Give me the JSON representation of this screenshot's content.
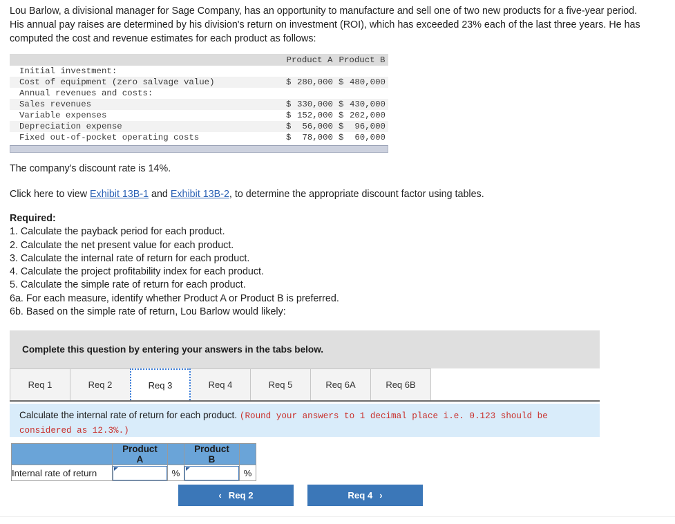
{
  "intro": {
    "paragraph": "Lou Barlow, a divisional manager for Sage Company, has an opportunity to manufacture and sell one of two new products for a five-year period. His annual pay raises are determined by his division's return on investment (ROI), which has exceeded 23% each of the last three years. He has computed the cost and revenue estimates for each product as follows:"
  },
  "fin_table": {
    "col_headers": [
      "",
      "Product A",
      "Product B"
    ],
    "rows": [
      {
        "label": "Initial investment:",
        "a_cur": "",
        "a_val": "",
        "b_cur": "",
        "b_val": ""
      },
      {
        "label": "Cost of equipment (zero salvage value)",
        "a_cur": "$",
        "a_val": "280,000",
        "b_cur": "$",
        "b_val": "480,000"
      },
      {
        "label": "Annual revenues and costs:",
        "a_cur": "",
        "a_val": "",
        "b_cur": "",
        "b_val": ""
      },
      {
        "label": "Sales revenues",
        "a_cur": "$",
        "a_val": "330,000",
        "b_cur": "$",
        "b_val": "430,000"
      },
      {
        "label": "Variable expenses",
        "a_cur": "$",
        "a_val": "152,000",
        "b_cur": "$",
        "b_val": "202,000"
      },
      {
        "label": "Depreciation expense",
        "a_cur": "$",
        "a_val": "56,000",
        "b_cur": "$",
        "b_val": "96,000"
      },
      {
        "label": "Fixed out-of-pocket operating costs",
        "a_cur": "$",
        "a_val": "78,000",
        "b_cur": "$",
        "b_val": "60,000"
      }
    ]
  },
  "discount": {
    "text": "The company's discount rate is 14%."
  },
  "exhibit_line": {
    "prefix": "Click here to view ",
    "link1": "Exhibit 13B-1",
    "middle": " and ",
    "link2": "Exhibit 13B-2",
    "suffix": ", to determine the appropriate discount factor using tables."
  },
  "required": {
    "heading": "Required:",
    "items": [
      "1. Calculate the payback period for each product.",
      "2. Calculate the net present value for each product.",
      "3. Calculate the internal rate of return for each product.",
      "4. Calculate the project profitability index for each product.",
      "5. Calculate the simple rate of return for each product.",
      "6a. For each measure, identify whether Product A or Product B is preferred.",
      "6b. Based on the simple rate of return, Lou Barlow would likely:"
    ]
  },
  "banner": {
    "text": "Complete this question by entering your answers in the tabs below."
  },
  "tabs": {
    "items": [
      {
        "label": "Req 1",
        "active": false
      },
      {
        "label": "Req 2",
        "active": false
      },
      {
        "label": "Req 3",
        "active": true
      },
      {
        "label": "Req 4",
        "active": false
      },
      {
        "label": "Req 5",
        "active": false
      },
      {
        "label": "Req 6A",
        "active": false
      },
      {
        "label": "Req 6B",
        "active": false
      }
    ]
  },
  "instruction": {
    "main": "Calculate the internal rate of return for each product. ",
    "note": "(Round your answers to 1 decimal place i.e. 0.123 should be considered as 12.3%.)"
  },
  "answer_table": {
    "headers": [
      "",
      "Product A",
      "",
      "Product B",
      ""
    ],
    "row_label": "Internal rate of return",
    "product_a_value": "",
    "product_b_value": "",
    "unit_a": "%",
    "unit_b": "%"
  },
  "nav": {
    "prev_label": "Req 2",
    "next_label": "Req 4",
    "prev_icon": "chevron-left",
    "next_icon": "chevron-right",
    "prev_chevron": "‹",
    "next_chevron": "›"
  },
  "colors": {
    "accent_blue": "#3b77b8",
    "header_blue": "#6aa4d8",
    "panel_blue": "#d9ecfa",
    "banner_gray": "#dfdfdf",
    "link_blue": "#2c62b5",
    "note_red": "#c9302c"
  }
}
